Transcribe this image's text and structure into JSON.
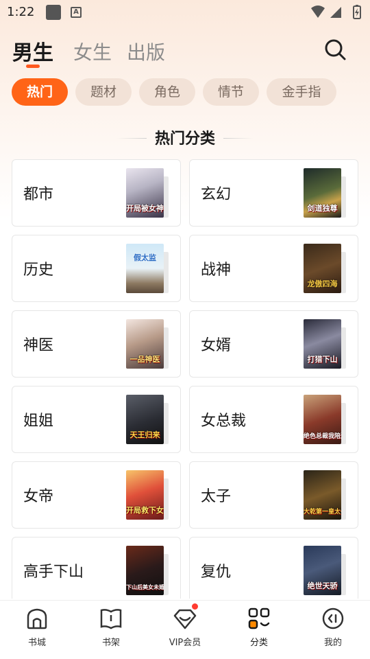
{
  "status_bar": {
    "time": "1:22",
    "icons": [
      "app-square-icon",
      "keyboard-a-icon",
      "wifi-icon",
      "signal-icon",
      "battery-charging-icon"
    ]
  },
  "top_tabs": [
    {
      "label": "男生",
      "active": true
    },
    {
      "label": "女生",
      "active": false
    },
    {
      "label": "出版",
      "active": false
    }
  ],
  "search": {
    "icon": "search-icon"
  },
  "chips": [
    {
      "label": "热门",
      "active": true
    },
    {
      "label": "题材",
      "active": false
    },
    {
      "label": "角色",
      "active": false
    },
    {
      "label": "情节",
      "active": false
    },
    {
      "label": "金手指",
      "active": false
    }
  ],
  "section": {
    "title": "热门分类"
  },
  "categories": [
    {
      "label": "都市",
      "cover_text": "开局被女神表白"
    },
    {
      "label": "玄幻",
      "cover_text": "剑道独尊"
    },
    {
      "label": "历史",
      "cover_text": "假太监"
    },
    {
      "label": "战神",
      "cover_text": "龙傲四海"
    },
    {
      "label": "神医",
      "cover_text": "一品神医"
    },
    {
      "label": "女婿",
      "cover_text": "打猎下山"
    },
    {
      "label": "姐姐",
      "cover_text": "天王归来"
    },
    {
      "label": "女总裁",
      "cover_text": "绝色总裁我陪送逃"
    },
    {
      "label": "女帝",
      "cover_text": "开局救下女帝"
    },
    {
      "label": "太子",
      "cover_text": "大乾第一皇太子"
    },
    {
      "label": "高手下山",
      "cover_text": "下山后美女未婚妻吧"
    },
    {
      "label": "复仇",
      "cover_text": "绝世天骄"
    }
  ],
  "bottom_nav": [
    {
      "label": "书城",
      "icon": "home-icon",
      "active": false
    },
    {
      "label": "书架",
      "icon": "book-icon",
      "active": false
    },
    {
      "label": "VIP会员",
      "icon": "vip-crown-icon",
      "active": false,
      "badge": true
    },
    {
      "label": "分类",
      "icon": "category-grid-icon",
      "active": true
    },
    {
      "label": "我的",
      "icon": "profile-icon",
      "active": false
    }
  ],
  "colors": {
    "accent": "#ff6417",
    "tab_indicator": "#ff5a1f",
    "chip_bg": "#f2e2d7",
    "badge": "#ff3b30"
  }
}
